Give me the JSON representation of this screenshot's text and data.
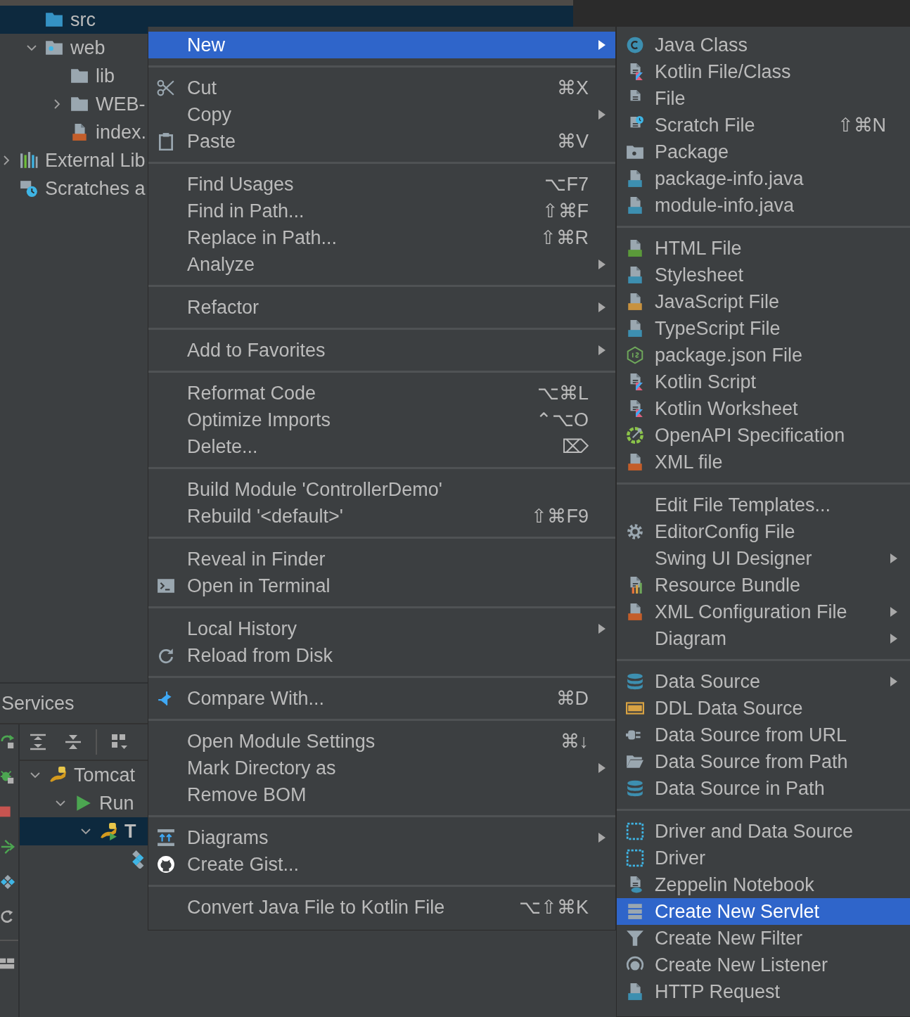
{
  "project_tree": {
    "module_children": [
      {
        "label": "src",
        "selected": true
      },
      {
        "label": "web",
        "selected": false,
        "expanded": true,
        "children": [
          {
            "label": "lib",
            "selected": false
          },
          {
            "label": "WEB-",
            "selected": false,
            "expanded": false
          },
          {
            "label": "index.",
            "selected": false
          }
        ]
      }
    ],
    "root_items": [
      {
        "label": "External Lib",
        "selected": false,
        "expanded": false
      },
      {
        "label": "Scratches a",
        "selected": false
      }
    ]
  },
  "services": {
    "title": "Services",
    "tree": [
      {
        "label": "Tomcat",
        "selected": false,
        "expanded": true,
        "children": [
          {
            "label": "Run",
            "selected": false,
            "expanded": true,
            "children": [
              {
                "label": "T",
                "selected": true,
                "expanded": true
              }
            ]
          }
        ]
      }
    ]
  },
  "context_menu": {
    "groups": [
      {
        "items": [
          {
            "label": "New",
            "submenu": true,
            "selected": true
          }
        ]
      },
      {
        "items": [
          {
            "label": "Cut",
            "shortcut": "⌘X",
            "submenu": false,
            "selected": false
          },
          {
            "label": "Copy",
            "submenu": true,
            "selected": false
          },
          {
            "label": "Paste",
            "shortcut": "⌘V",
            "submenu": false,
            "selected": false
          }
        ]
      },
      {
        "items": [
          {
            "label": "Find Usages",
            "shortcut": "⌥F7",
            "submenu": false,
            "selected": false
          },
          {
            "label": "Find in Path...",
            "shortcut": "⇧⌘F",
            "submenu": false,
            "selected": false
          },
          {
            "label": "Replace in Path...",
            "shortcut": "⇧⌘R",
            "submenu": false,
            "selected": false
          },
          {
            "label": "Analyze",
            "submenu": true,
            "selected": false
          }
        ]
      },
      {
        "items": [
          {
            "label": "Refactor",
            "submenu": true,
            "selected": false
          }
        ]
      },
      {
        "items": [
          {
            "label": "Add to Favorites",
            "submenu": true,
            "selected": false
          }
        ]
      },
      {
        "items": [
          {
            "label": "Reformat Code",
            "shortcut": "⌥⌘L",
            "submenu": false,
            "selected": false
          },
          {
            "label": "Optimize Imports",
            "shortcut": "⌃⌥O",
            "submenu": false,
            "selected": false
          },
          {
            "label": "Delete...",
            "shortcut": "⌦",
            "submenu": false,
            "selected": false
          }
        ]
      },
      {
        "items": [
          {
            "label": "Build Module 'ControllerDemo'",
            "submenu": false,
            "selected": false
          },
          {
            "label": "Rebuild '<default>'",
            "shortcut": "⇧⌘F9",
            "submenu": false,
            "selected": false
          }
        ]
      },
      {
        "items": [
          {
            "label": "Reveal in Finder",
            "submenu": false,
            "selected": false
          },
          {
            "label": "Open in Terminal",
            "submenu": false,
            "selected": false
          }
        ]
      },
      {
        "items": [
          {
            "label": "Local History",
            "submenu": true,
            "selected": false
          },
          {
            "label": "Reload from Disk",
            "submenu": false,
            "selected": false
          }
        ]
      },
      {
        "items": [
          {
            "label": "Compare With...",
            "shortcut": "⌘D",
            "submenu": false,
            "selected": false
          }
        ]
      },
      {
        "items": [
          {
            "label": "Open Module Settings",
            "shortcut": "⌘↓",
            "submenu": false,
            "selected": false
          },
          {
            "label": "Mark Directory as",
            "submenu": true,
            "selected": false
          },
          {
            "label": "Remove BOM",
            "submenu": false,
            "selected": false
          }
        ]
      },
      {
        "items": [
          {
            "label": "Diagrams",
            "submenu": true,
            "selected": false
          },
          {
            "label": "Create Gist...",
            "submenu": false,
            "selected": false
          }
        ]
      },
      {
        "items": [
          {
            "label": "Convert Java File to Kotlin File",
            "shortcut": "⌥⇧⌘K",
            "submenu": false,
            "selected": false
          }
        ]
      }
    ]
  },
  "new_submenu": {
    "groups": [
      {
        "items": [
          {
            "label": "Java Class",
            "submenu": false,
            "selected": false
          },
          {
            "label": "Kotlin File/Class",
            "submenu": false,
            "selected": false
          },
          {
            "label": "File",
            "submenu": false,
            "selected": false
          },
          {
            "label": "Scratch File",
            "shortcut": "⇧⌘N",
            "submenu": false,
            "selected": false
          },
          {
            "label": "Package",
            "submenu": false,
            "selected": false
          },
          {
            "label": "package-info.java",
            "submenu": false,
            "selected": false
          },
          {
            "label": "module-info.java",
            "submenu": false,
            "selected": false
          }
        ]
      },
      {
        "items": [
          {
            "label": "HTML File",
            "submenu": false,
            "selected": false
          },
          {
            "label": "Stylesheet",
            "submenu": false,
            "selected": false
          },
          {
            "label": "JavaScript File",
            "submenu": false,
            "selected": false
          },
          {
            "label": "TypeScript File",
            "submenu": false,
            "selected": false
          },
          {
            "label": "package.json File",
            "submenu": false,
            "selected": false
          },
          {
            "label": "Kotlin Script",
            "submenu": false,
            "selected": false
          },
          {
            "label": "Kotlin Worksheet",
            "submenu": false,
            "selected": false
          },
          {
            "label": "OpenAPI Specification",
            "submenu": false,
            "selected": false
          },
          {
            "label": "XML file",
            "submenu": false,
            "selected": false
          }
        ]
      },
      {
        "items": [
          {
            "label": "Edit File Templates...",
            "submenu": false,
            "selected": false
          },
          {
            "label": "EditorConfig File",
            "submenu": false,
            "selected": false
          },
          {
            "label": "Swing UI Designer",
            "submenu": true,
            "selected": false
          },
          {
            "label": "Resource Bundle",
            "submenu": false,
            "selected": false
          },
          {
            "label": "XML Configuration File",
            "submenu": true,
            "selected": false
          },
          {
            "label": "Diagram",
            "submenu": true,
            "selected": false
          }
        ]
      },
      {
        "items": [
          {
            "label": "Data Source",
            "submenu": true,
            "selected": false
          },
          {
            "label": "DDL Data Source",
            "submenu": false,
            "selected": false
          },
          {
            "label": "Data Source from URL",
            "submenu": false,
            "selected": false
          },
          {
            "label": "Data Source from Path",
            "submenu": false,
            "selected": false
          },
          {
            "label": "Data Source in Path",
            "submenu": false,
            "selected": false
          }
        ]
      },
      {
        "items": [
          {
            "label": "Driver and Data Source",
            "submenu": false,
            "selected": false
          },
          {
            "label": "Driver",
            "submenu": false,
            "selected": false
          },
          {
            "label": "Zeppelin Notebook",
            "submenu": false,
            "selected": false
          },
          {
            "label": "Create New Servlet",
            "submenu": false,
            "selected": true
          },
          {
            "label": "Create New Filter",
            "submenu": false,
            "selected": false
          },
          {
            "label": "Create New Listener",
            "submenu": false,
            "selected": false
          },
          {
            "label": "HTTP Request",
            "submenu": false,
            "selected": false
          }
        ]
      }
    ]
  }
}
